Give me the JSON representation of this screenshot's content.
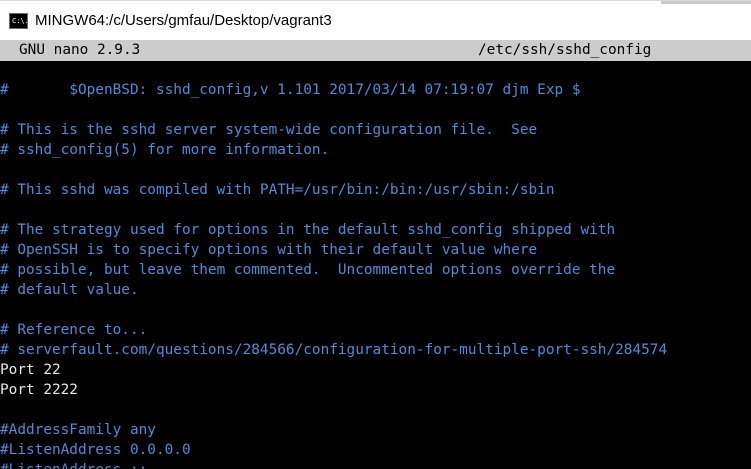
{
  "window": {
    "title": "MINGW64:/c/Users/gmfau/Desktop/vagrant3",
    "icon": "terminal-icon",
    "icon_text": "C:\\."
  },
  "nano": {
    "version": "GNU nano 2.9.3",
    "filename": "/etc/ssh/sshd_config"
  },
  "colors": {
    "comment": "#4f8cd8",
    "plain": "#e8e8e8",
    "background": "#000000",
    "header_bg": "#cccccc"
  },
  "lines": [
    {
      "text": "#       $OpenBSD: sshd_config,v 1.101 2017/03/14 07:19:07 djm Exp $",
      "type": "comment"
    },
    {
      "text": "",
      "type": "plain"
    },
    {
      "text": "# This is the sshd server system-wide configuration file.  See",
      "type": "comment"
    },
    {
      "text": "# sshd_config(5) for more information.",
      "type": "comment"
    },
    {
      "text": "",
      "type": "plain"
    },
    {
      "text": "# This sshd was compiled with PATH=/usr/bin:/bin:/usr/sbin:/sbin",
      "type": "comment"
    },
    {
      "text": "",
      "type": "plain"
    },
    {
      "text": "# The strategy used for options in the default sshd_config shipped with",
      "type": "comment"
    },
    {
      "text": "# OpenSSH is to specify options with their default value where",
      "type": "comment"
    },
    {
      "text": "# possible, but leave them commented.  Uncommented options override the",
      "type": "comment"
    },
    {
      "text": "# default value.",
      "type": "comment"
    },
    {
      "text": "",
      "type": "plain"
    },
    {
      "text": "# Reference to...",
      "type": "comment"
    },
    {
      "text": "# serverfault.com/questions/284566/configuration-for-multiple-port-ssh/284574",
      "type": "comment"
    },
    {
      "text": "Port 22",
      "type": "plain"
    },
    {
      "text": "Port 2222",
      "type": "plain"
    },
    {
      "text": "",
      "type": "plain"
    },
    {
      "text": "#AddressFamily any",
      "type": "comment"
    },
    {
      "text": "#ListenAddress 0.0.0.0",
      "type": "comment"
    },
    {
      "text": "#ListenAddress ::",
      "type": "comment"
    }
  ]
}
